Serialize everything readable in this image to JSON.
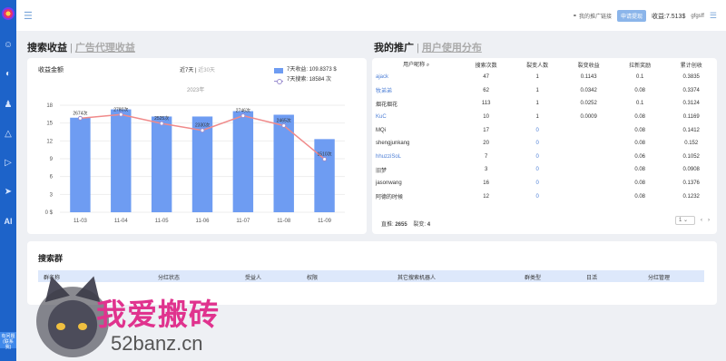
{
  "topbar": {
    "share_link": "我的推广链接",
    "badge": "申请提现",
    "income_text": "收益:7.513$",
    "username": "gfgsff"
  },
  "sidebar": {
    "icons": [
      "user-icon",
      "chart-icon",
      "people-icon",
      "shield-icon",
      "play-icon",
      "send-icon",
      "ai-icon"
    ],
    "ai_label": "AI",
    "badge_text": "有问题(联系我)"
  },
  "search_income": {
    "title": "搜索收益",
    "separator": "|",
    "alt_tab": "广告代理收益",
    "chart_label": "收益金额",
    "range_active": "近7天",
    "range_sep": "|",
    "range_inactive": "近30天",
    "year_label": "2023年",
    "legend": {
      "income": "7天收益: 109.8373 $",
      "searches": "7天搜索: 18584 次"
    }
  },
  "chart_data": {
    "type": "bar",
    "categories": [
      "11-03",
      "11-04",
      "11-05",
      "11-06",
      "11-07",
      "11-08",
      "11-09"
    ],
    "series": [
      {
        "values": [
          15.9,
          17.3,
          16.1,
          16.1,
          17.0,
          16.4,
          12.3
        ],
        "color": "#6e9cf2"
      },
      {
        "values": [
          2674,
          2780,
          2525,
          2330,
          2746,
          2465,
          1510
        ],
        "color": "#f08a8a"
      }
    ],
    "point_labels": [
      "2674次",
      "2780次",
      "2525次",
      "2330次",
      "2746次",
      "2465次",
      "1510次"
    ],
    "yticks": [
      "0 $",
      "3",
      "6",
      "9",
      "12",
      "15",
      "18"
    ],
    "ylim": [
      0,
      18
    ]
  },
  "promotion": {
    "title": "我的推广",
    "separator": "|",
    "alt_tab": "用户使用分布",
    "columns": [
      "用户昵称",
      "搜索次数",
      "裂变人数",
      "裂变收益",
      "拉新奖励",
      "累计创收"
    ],
    "rows": [
      [
        "ajack",
        "47",
        "1",
        "0.1143",
        "0.1",
        "0.3835"
      ],
      [
        "牧弟弟",
        "62",
        "1",
        "0.0342",
        "0.08",
        "0.3374"
      ],
      [
        "烟花烟花",
        "113",
        "1",
        "0.0252",
        "0.1",
        "0.3124"
      ],
      [
        "KuC",
        "10",
        "1",
        "0.0009",
        "0.08",
        "0.1169"
      ],
      [
        "MQi",
        "17",
        "0",
        "",
        "0.08",
        "0.1412"
      ],
      [
        "shengjunkang",
        "20",
        "0",
        "",
        "0.08",
        "0.152"
      ],
      [
        "hhuzziSoL",
        "7",
        "0",
        "",
        "0.06",
        "0.1052"
      ],
      [
        "旧梦",
        "3",
        "0",
        "",
        "0.08",
        "0.0908"
      ],
      [
        "jasonwang",
        "16",
        "0",
        "",
        "0.08",
        "0.1376"
      ],
      [
        "阿德的时候",
        "12",
        "0",
        "",
        "0.08",
        "0.1232"
      ]
    ],
    "totals_direct_label": "直推:",
    "totals_direct": "2655",
    "totals_fission_label": "裂变:",
    "totals_fission": "4",
    "page_select": "1",
    "prev": "‹",
    "next": "›"
  },
  "search_groups": {
    "title": "搜索群",
    "columns": [
      "群名称",
      "分红状态",
      "受益人",
      "权限",
      "其它搜索机器人",
      "群类型",
      "日活",
      "分红管理"
    ]
  },
  "watermark": {
    "title": "我爱搬砖",
    "url": "52banz.cn"
  }
}
